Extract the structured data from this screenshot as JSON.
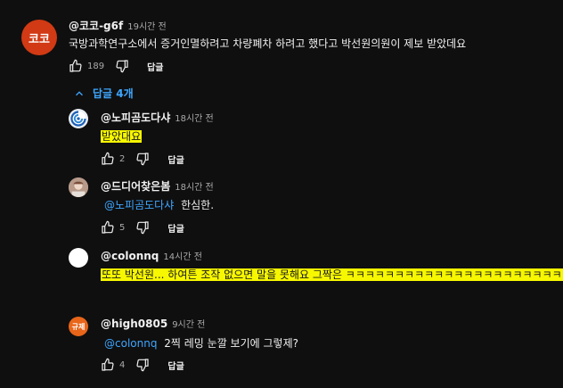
{
  "top": {
    "avatar_text": "코코",
    "avatar_color": "#d13a14",
    "author": "@코코-g6f",
    "time": "19시간 전",
    "text": "국방과학연구소에서 증거인멸하려고 차량폐차 하려고 했다고 박선원의원이 제보 받았데요",
    "likes": "189",
    "reply_label": "답글"
  },
  "replies_toggle": "답글 4개",
  "replies": [
    {
      "author": "@노피곰도다샤",
      "time": "18시간 전",
      "mention": "",
      "text": "받았대요",
      "likes": "2",
      "reply_label": "답글"
    },
    {
      "author": "@드디어찾은봄",
      "time": "18시간 전",
      "mention": "@노피곰도다샤",
      "text": "한심한.",
      "likes": "5",
      "reply_label": "답글"
    },
    {
      "author": "@colonnq",
      "time": "14시간 전",
      "mention": "",
      "text": "또또 박선원... 하여튼 조작 없으면 말을 못해요 그짝은 ㅋㅋㅋㅋㅋㅋㅋㅋㅋㅋㅋㅋㅋㅋㅋㅋㅋㅋㅋㅋㅋㅋ",
      "likes": "",
      "reply_label": ""
    },
    {
      "avatar_text": "규제",
      "avatar_color": "#e8651a",
      "author": "@high0805",
      "time": "9시간 전",
      "mention": "@colonnq",
      "text": "2찍 레밍 눈깔 보기에 그렇제?",
      "likes": "4",
      "reply_label": "답글"
    }
  ],
  "colors": {
    "link": "#3ea6ff",
    "highlight": "#f7f700",
    "background": "#0f0f0f"
  },
  "icons": [
    "thumb-up-icon",
    "thumb-down-icon",
    "chevron-up-icon"
  ]
}
